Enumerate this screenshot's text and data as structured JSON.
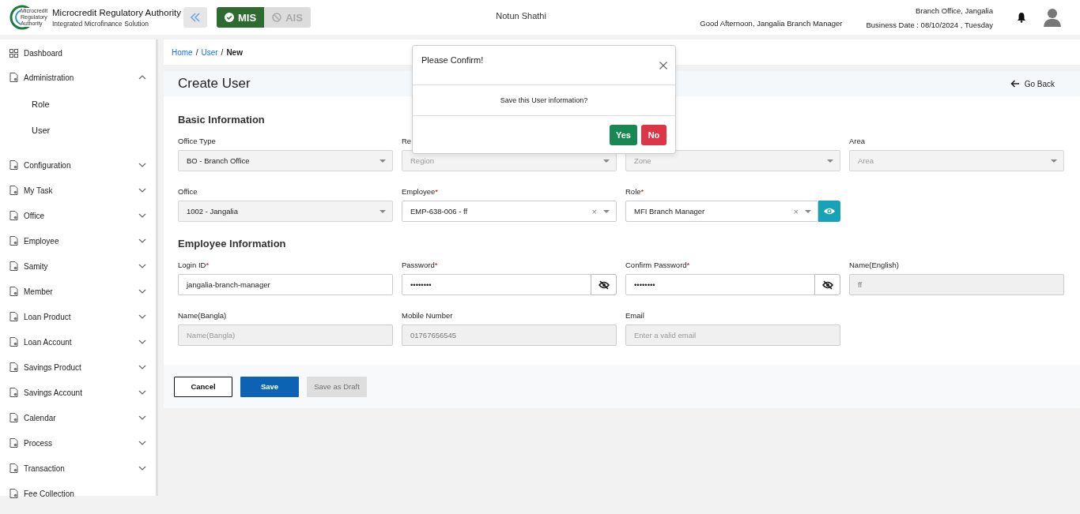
{
  "header": {
    "logo_text": "Microcredit Regulatory Authority",
    "title": "Microcredit Regulatory Authority",
    "subtitle": "Integrated Microfinance Solution",
    "modules": [
      {
        "label": "MIS",
        "selected": true
      },
      {
        "label": "AIS",
        "selected": false
      }
    ],
    "app_name": "Notun Shathi",
    "greeting": "Good Afternoon, Jangalia Branch Manager",
    "office": "Branch Office, Jangalia",
    "business_date": "Business Date : 08/10/2024 , Tuesday"
  },
  "sidebar": {
    "items": [
      {
        "label": "Dashboard",
        "kind": "link"
      },
      {
        "label": "Administration",
        "kind": "group",
        "expanded": true,
        "children": [
          {
            "label": "Role"
          },
          {
            "label": "User"
          }
        ]
      },
      {
        "label": "Configuration",
        "kind": "group",
        "expanded": false
      },
      {
        "label": "My Task",
        "kind": "group",
        "expanded": false
      },
      {
        "label": "Office",
        "kind": "group",
        "expanded": false
      },
      {
        "label": "Employee",
        "kind": "group",
        "expanded": false
      },
      {
        "label": "Samity",
        "kind": "group",
        "expanded": false
      },
      {
        "label": "Member",
        "kind": "group",
        "expanded": false
      },
      {
        "label": "Loan Product",
        "kind": "group",
        "expanded": false
      },
      {
        "label": "Loan Account",
        "kind": "group",
        "expanded": false
      },
      {
        "label": "Savings Product",
        "kind": "group",
        "expanded": false
      },
      {
        "label": "Savings Account",
        "kind": "group",
        "expanded": false
      },
      {
        "label": "Calendar",
        "kind": "group",
        "expanded": false
      },
      {
        "label": "Process",
        "kind": "group",
        "expanded": false
      },
      {
        "label": "Transaction",
        "kind": "group",
        "expanded": false
      },
      {
        "label": "Fee Collection",
        "kind": "link"
      }
    ]
  },
  "breadcrumb": [
    {
      "label": "Home",
      "kind": "link"
    },
    {
      "label": "User",
      "kind": "link",
      "separator": "/"
    },
    {
      "label": "New",
      "kind": "current",
      "separator": "/"
    }
  ],
  "page": {
    "title": "Create User",
    "back": "Go Back"
  },
  "sections": [
    {
      "title": "Basic Information",
      "rows": [
        [
          {
            "label": "Office Type",
            "kind": "select",
            "value": "BO - Branch Office",
            "disabled": true
          },
          {
            "label": "Re",
            "kind": "select",
            "placeholder": "Region",
            "disabled": true
          },
          {
            "kind": "select",
            "placeholder": "Zone",
            "disabled": true
          },
          {
            "label": "Area",
            "kind": "select",
            "placeholder": "Area",
            "disabled": true
          }
        ],
        [
          {
            "label": "Office",
            "kind": "select",
            "value": "1002 - Jangalia",
            "disabled": true
          },
          {
            "label": "Employee",
            "required_mark": "*",
            "kind": "select",
            "value": "EMP-638-006 - ff",
            "disabled": false,
            "clear_icon": "×"
          },
          {
            "label": "Role",
            "required_mark": "*",
            "kind": "select-view",
            "value": "MFI Branch Manager",
            "disabled": false,
            "clear_icon": "×"
          }
        ]
      ]
    },
    {
      "title": "Employee Information",
      "rows": [
        [
          {
            "label": "Login ID",
            "required_mark": "*",
            "kind": "text",
            "value": "jangalia-branch-manager",
            "disabled": false
          },
          {
            "label": "Password",
            "required_mark": "*",
            "kind": "password",
            "value": "••••••••",
            "disabled": false
          },
          {
            "label": "Confirm Password",
            "required_mark": "*",
            "kind": "password",
            "value": "••••••••",
            "disabled": false
          },
          {
            "label": "Name(English)",
            "kind": "text",
            "value": "ff",
            "disabled": true
          }
        ],
        [
          {
            "label": "Name(Bangla)",
            "kind": "text",
            "placeholder": "Name(Bangla)",
            "disabled": true
          },
          {
            "label": "Mobile Number",
            "kind": "text",
            "value": "01767656545",
            "disabled": true
          },
          {
            "label": "Email",
            "kind": "text",
            "placeholder": "Enter a valid email",
            "disabled": true
          }
        ]
      ]
    }
  ],
  "actions": [
    {
      "label": "Cancel",
      "kind": "outline",
      "disabled": false
    },
    {
      "label": "Save",
      "kind": "primary",
      "disabled": false
    },
    {
      "label": "Save as Draft",
      "kind": "primary",
      "disabled": true
    }
  ],
  "dialog": {
    "title": "Please Confirm!",
    "message": "Save this User information?",
    "buttons": [
      {
        "label": "Yes",
        "kind": "confirm"
      },
      {
        "label": "No",
        "kind": "cancel"
      }
    ]
  }
}
